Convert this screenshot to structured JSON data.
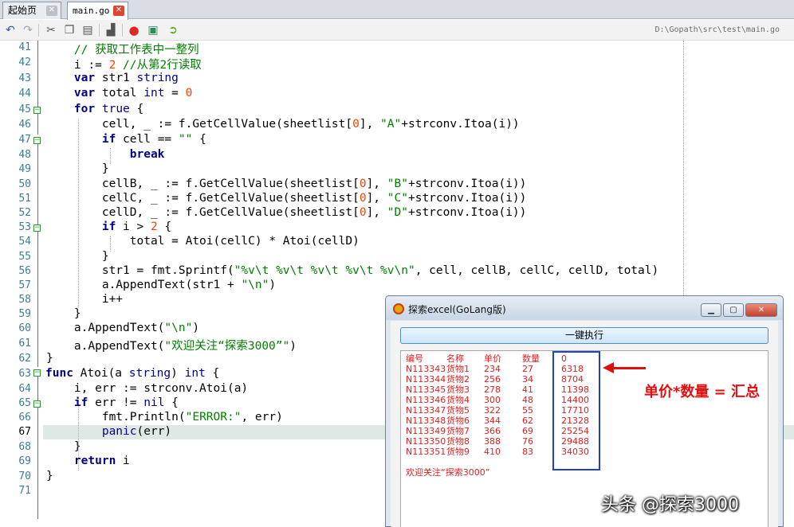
{
  "tabs": [
    {
      "label": "起始页",
      "active": false
    },
    {
      "label": "main.go",
      "active": true
    }
  ],
  "toolbar": {
    "buttons": [
      "undo-icon",
      "redo-icon",
      "cut-icon",
      "copy-icon",
      "paste-icon",
      "clear-icon",
      "breakpoint-icon",
      "build-icon",
      "run-icon"
    ],
    "file_path": "D:\\Gopath\\src\\test\\main.go"
  },
  "editor": {
    "current_line": 67,
    "line_numbers": [
      "41",
      "42",
      "43",
      "44",
      "45",
      "46",
      "47",
      "48",
      "49",
      "50",
      "51",
      "52",
      "53",
      "54",
      "55",
      "56",
      "57",
      "58",
      "59",
      "60",
      "61",
      "62",
      "63",
      "64",
      "65",
      "66",
      "67",
      "68",
      "69",
      "70",
      "71"
    ]
  },
  "window": {
    "title": "探索excel(GoLang版)",
    "min_label": "▁",
    "max_label": "▢",
    "close_label": "✕",
    "run_button": "一键执行",
    "headers": [
      "编号",
      "名称",
      "单价",
      "数量",
      "0"
    ],
    "rows": [
      [
        "N113343",
        "货物1",
        "234",
        "27",
        "6318"
      ],
      [
        "N113344",
        "货物2",
        "256",
        "34",
        "8704"
      ],
      [
        "N113345",
        "货物3",
        "278",
        "41",
        "11398"
      ],
      [
        "N113346",
        "货物4",
        "300",
        "48",
        "14400"
      ],
      [
        "N113347",
        "货物5",
        "322",
        "55",
        "17710"
      ],
      [
        "N113348",
        "货物6",
        "344",
        "62",
        "21328"
      ],
      [
        "N113349",
        "货物7",
        "366",
        "69",
        "25254"
      ],
      [
        "N113350",
        "货物8",
        "388",
        "76",
        "29488"
      ],
      [
        "N113351",
        "货物9",
        "410",
        "83",
        "34030"
      ]
    ],
    "footer": "欢迎关注“探索3000”"
  },
  "annotation": "单价*数量 = 汇总",
  "watermark": "头条 @探索3000",
  "colors": {
    "accent_red": "#e01010",
    "highlight_blue": "#1f3fd6",
    "keyword": "#00008b",
    "string": "#008000"
  }
}
